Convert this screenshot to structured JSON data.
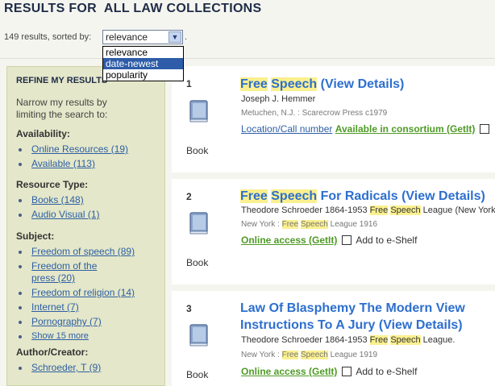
{
  "header": {
    "title": "RESULTS FOR  ALL LAW COLLECTIONS"
  },
  "sort": {
    "summary": "149 results, sorted by:",
    "selected": "relevance",
    "options": [
      "relevance",
      "date-newest",
      "popularity"
    ],
    "highlighted_option": "date-newest",
    "suffix": "."
  },
  "sidebar": {
    "title": "REFINE MY RESULTS",
    "intro": "Narrow my results by limiting the search to:",
    "facets": [
      {
        "heading": "Availability:",
        "items": [
          "Online Resources (19)",
          "Available (113)"
        ]
      },
      {
        "heading": "Resource Type:",
        "items": [
          "Books (148)",
          "Audio Visual (1)"
        ]
      },
      {
        "heading": "Subject:",
        "items": [
          "Freedom of speech (89)",
          "Freedom of the press (20)",
          "Freedom of religion (14)",
          "Internet (7)",
          "Pornography (7)"
        ],
        "more": "Show 15 more"
      },
      {
        "heading": "Author/Creator:",
        "items": [
          "Schroeder, T (9)"
        ]
      }
    ]
  },
  "results": [
    {
      "number": "1",
      "type_label": "Book",
      "title_parts": [
        "Free",
        " ",
        "Speech",
        " (View Details)"
      ],
      "author": "Joseph J. Hemmer",
      "pub": "Metuchen, N.J. : Scarecrow Press c1979",
      "location_link": "Location/Call number",
      "access": "Available in consortium (GetIt)"
    },
    {
      "number": "2",
      "type_label": "Book",
      "title_parts": [
        "Free",
        " ",
        "Speech",
        " For Radicals (View Details)"
      ],
      "author_parts": [
        "Theodore Schroeder 1864-1953 ",
        "Free",
        " ",
        "Speech",
        " League (New York)"
      ],
      "pub_parts": [
        "New York : ",
        "Free",
        " ",
        "Speech",
        " League 1916"
      ],
      "access": "Online access (GetIt)",
      "eshelf": "Add to e-Shelf"
    },
    {
      "number": "3",
      "type_label": "Book",
      "title": "Law Of Blasphemy The Modern View Instructions To A Jury (View Details)",
      "author_parts": [
        "Theodore Schroeder 1864-1953 ",
        "Free",
        " ",
        "Speech",
        " League."
      ],
      "pub_parts": [
        "New York : ",
        "Free",
        " ",
        "Speech",
        " League 1919"
      ],
      "access": "Online access (GetIt)",
      "eshelf": "Add to e-Shelf"
    }
  ]
}
